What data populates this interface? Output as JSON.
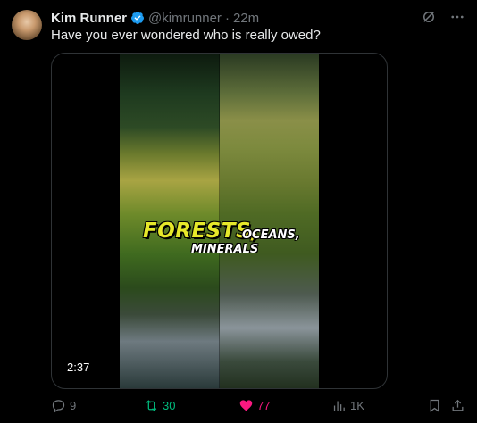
{
  "author": {
    "name": "Kim Runner",
    "handle": "@kimrunner",
    "separator": "·",
    "time": "22m"
  },
  "tweet": {
    "text": "Have you ever wondered who is really owed?"
  },
  "video": {
    "caption_main": "FORESTS,",
    "caption_sub1": "OCEANS,",
    "caption_sub2": "MINERALS",
    "duration": "2:37"
  },
  "actions": {
    "replies": "9",
    "retweets": "30",
    "likes": "77",
    "views": "1K"
  },
  "colors": {
    "retweet": "#00ba7c",
    "like": "#f91880",
    "verified": "#1d9bf0",
    "muted": "#71767b"
  },
  "icons": [
    "verified-badge-icon",
    "grok-icon",
    "more-icon",
    "reply-icon",
    "retweet-icon",
    "heart-icon",
    "views-icon",
    "bookmark-icon",
    "share-icon"
  ]
}
